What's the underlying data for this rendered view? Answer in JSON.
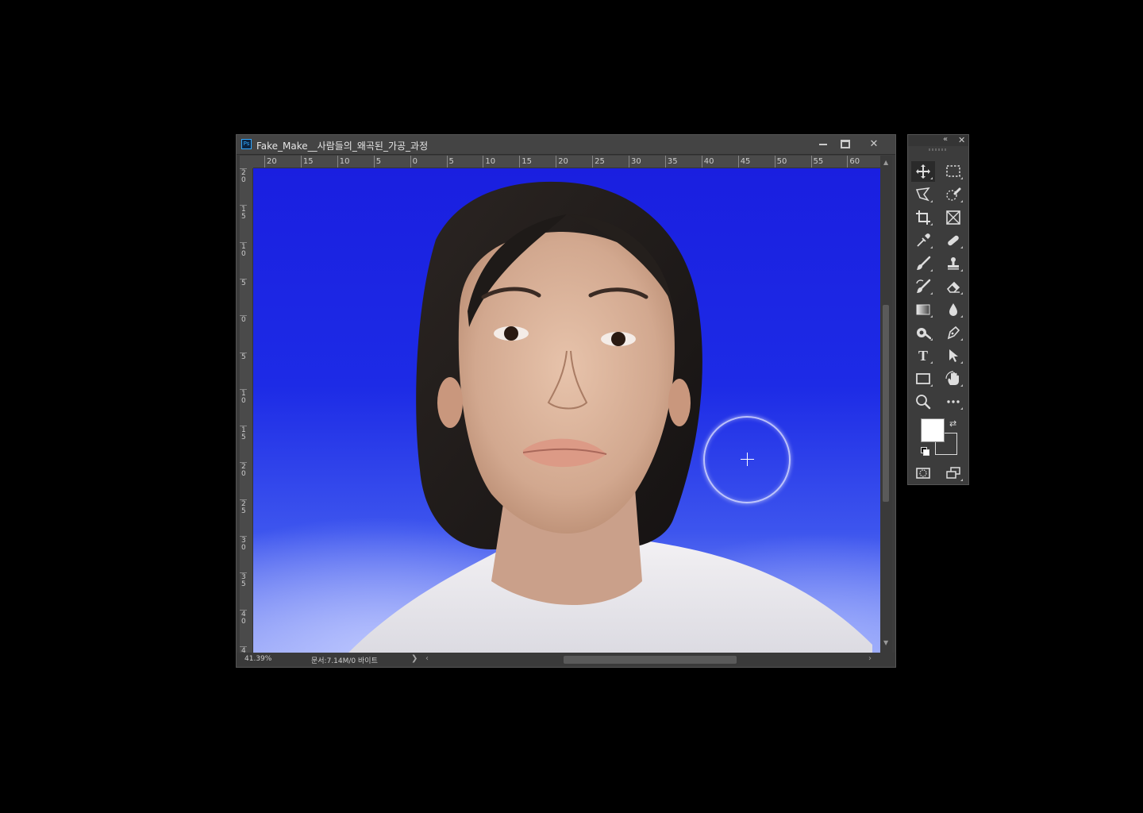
{
  "document": {
    "title": "Fake_Make__사람들의_왜곡된_가공_과정",
    "app_badge": "Ps",
    "controls": {
      "minimize": "",
      "maximize": "",
      "close": "✕"
    },
    "ruler_h": [
      "20",
      "15",
      "10",
      "5",
      "0",
      "5",
      "10",
      "15",
      "20",
      "25",
      "30",
      "35",
      "40",
      "45",
      "50",
      "55",
      "60"
    ],
    "ruler_v": [
      "20",
      "15",
      "10",
      "5",
      "0",
      "5",
      "10",
      "15",
      "20",
      "25",
      "30",
      "35",
      "40",
      "4"
    ],
    "status": {
      "zoom": "41.39%",
      "doc_info": "문서:7.14M/0 바이트",
      "arrow": "❯"
    },
    "canvas": {
      "background_color": "#1d2be6",
      "subject": "portrait photo"
    },
    "cursor": {
      "tool": "brush",
      "icon": "crosshair-icon"
    }
  },
  "tools_panel": {
    "collapse": "«",
    "close": "✕",
    "tools": [
      {
        "name": "move-tool",
        "icon": "move-icon"
      },
      {
        "name": "marquee-tool",
        "icon": "rect-marquee-icon"
      },
      {
        "name": "lasso-tool",
        "icon": "polygon-lasso-icon"
      },
      {
        "name": "quick-select-tool",
        "icon": "quick-select-icon"
      },
      {
        "name": "crop-tool",
        "icon": "crop-icon"
      },
      {
        "name": "frame-tool",
        "icon": "frame-icon"
      },
      {
        "name": "eyedropper-tool",
        "icon": "eyedropper-icon"
      },
      {
        "name": "healing-tool",
        "icon": "bandage-icon"
      },
      {
        "name": "brush-tool",
        "icon": "brush-icon"
      },
      {
        "name": "stamp-tool",
        "icon": "stamp-icon"
      },
      {
        "name": "history-brush-tool",
        "icon": "history-brush-icon"
      },
      {
        "name": "eraser-tool",
        "icon": "eraser-icon"
      },
      {
        "name": "gradient-tool",
        "icon": "gradient-icon"
      },
      {
        "name": "blur-tool",
        "icon": "drop-icon"
      },
      {
        "name": "dodge-tool",
        "icon": "dodge-icon"
      },
      {
        "name": "pen-tool",
        "icon": "pen-icon"
      },
      {
        "name": "type-tool",
        "icon": "type-icon",
        "label": "T"
      },
      {
        "name": "path-select-tool",
        "icon": "arrow-icon"
      },
      {
        "name": "shape-tool",
        "icon": "rectangle-icon"
      },
      {
        "name": "hand-tool",
        "icon": "hand-icon"
      },
      {
        "name": "zoom-tool",
        "icon": "magnifier-icon"
      },
      {
        "name": "more-tools",
        "icon": "more-icon",
        "label": "•••"
      },
      {
        "name": "quick-mask",
        "icon": "quick-mask-icon"
      },
      {
        "name": "screen-mode",
        "icon": "screen-mode-icon"
      }
    ],
    "foreground_color": "#ffffff",
    "background_color": "#3c3c3c"
  }
}
